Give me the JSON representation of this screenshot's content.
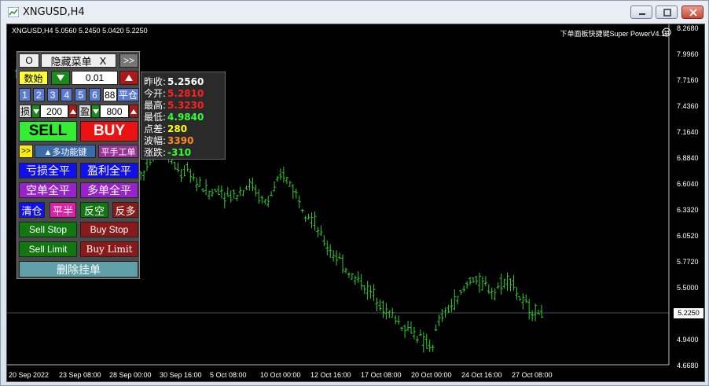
{
  "window": {
    "title": "XNGUSD,H4"
  },
  "chart_header": {
    "symbol_line": "XNGUSD,H4  5.0560 5.2450 5.0420 5.2250",
    "ea_name": "下单面板快捷键Super PowerV4.1B"
  },
  "panel": {
    "o_label": "O",
    "hide_menu_label": "隐藏菜单",
    "close_label": "X",
    "expand_label": ">>",
    "qty_label": "数始",
    "lot_value": "0.01",
    "quick_lots": [
      "1",
      "2",
      "3",
      "4",
      "5",
      "6",
      "88"
    ],
    "close_pos_label": "平仓",
    "sl_label": "损",
    "sl_value": "200",
    "tp_label": "盈",
    "tp_value": "800",
    "sell_label": "SELL",
    "buy_label": "BUY",
    "more_label": ">>",
    "multi_func_label": "▲多功能键",
    "manual_close_label": "平手工单",
    "close_loss_label": "亏损全平",
    "close_profit_label": "盈利全平",
    "close_short_label": "空单全平",
    "close_long_label": "多单全平",
    "clear_label": "清仓",
    "half_label": "平半",
    "reverse_short_label": "反空",
    "reverse_long_label": "反多",
    "sell_stop_label": "Sell Stop",
    "buy_stop_label": "Buy Stop",
    "sell_limit_label": "Sell Limit",
    "buy_limit_label": "Buy Limit",
    "delete_pending_label": "删除挂单"
  },
  "info": {
    "rows": [
      {
        "label": "昨收:",
        "value": "5.2560",
        "color": "#ffffff"
      },
      {
        "label": "今开:",
        "value": "5.2810",
        "color": "#ff2020"
      },
      {
        "label": "最高:",
        "value": "5.3230",
        "color": "#ff2020"
      },
      {
        "label": "最低:",
        "value": "4.9840",
        "color": "#33ff33"
      },
      {
        "label": "点差:",
        "value": "280",
        "color": "#ffff00"
      },
      {
        "label": "波幅:",
        "value": "3390",
        "color": "#ff8c1a"
      },
      {
        "label": "涨跌:",
        "value": "-310",
        "color": "#33ff33"
      }
    ]
  },
  "price_axis": {
    "labels": [
      "8.2680",
      "7.9960",
      "7.7160",
      "7.4360",
      "7.1640",
      "6.8840",
      "6.6040",
      "6.3320",
      "6.0520",
      "5.7720",
      "5.5000",
      "5.2250",
      "4.9400",
      "4.6680"
    ],
    "current_price": "5.2250"
  },
  "time_axis": {
    "labels": [
      "20 Sep 2022",
      "23 Sep 08:00",
      "28 Sep 00:00",
      "30 Sep 16:00",
      "5 Oct 08:00",
      "10 Oct 00:00",
      "12 Oct 16:00",
      "17 Oct 08:00",
      "20 Oct 00:00",
      "24 Oct 16:00",
      "27 Oct 08:00"
    ]
  },
  "chart_data": {
    "type": "bar",
    "series_color": "#33cc33",
    "ylim": [
      4.668,
      8.268
    ],
    "ohlc_path_y": [
      7.8,
      7.6,
      7.35,
      7.5,
      7.2,
      7.05,
      6.9,
      7.1,
      6.95,
      6.75,
      6.4,
      6.35,
      6.55,
      6.45,
      6.8,
      6.9,
      6.7,
      6.85,
      7.05,
      6.95,
      6.8,
      6.7,
      6.75,
      6.6,
      6.55,
      6.5,
      6.55,
      6.45,
      6.5,
      6.55,
      6.6,
      6.45,
      6.4,
      6.55,
      6.7,
      6.6,
      6.45,
      6.3,
      6.2,
      6.0,
      5.9,
      5.8,
      5.7,
      5.6,
      5.55,
      5.45,
      5.4,
      5.25,
      5.2,
      5.1,
      5.05,
      5.0,
      4.9,
      4.85,
      5.15,
      5.25,
      5.35,
      5.45,
      5.6,
      5.55,
      5.5,
      5.45,
      5.55,
      5.6,
      5.4,
      5.3,
      5.25,
      5.22
    ]
  }
}
